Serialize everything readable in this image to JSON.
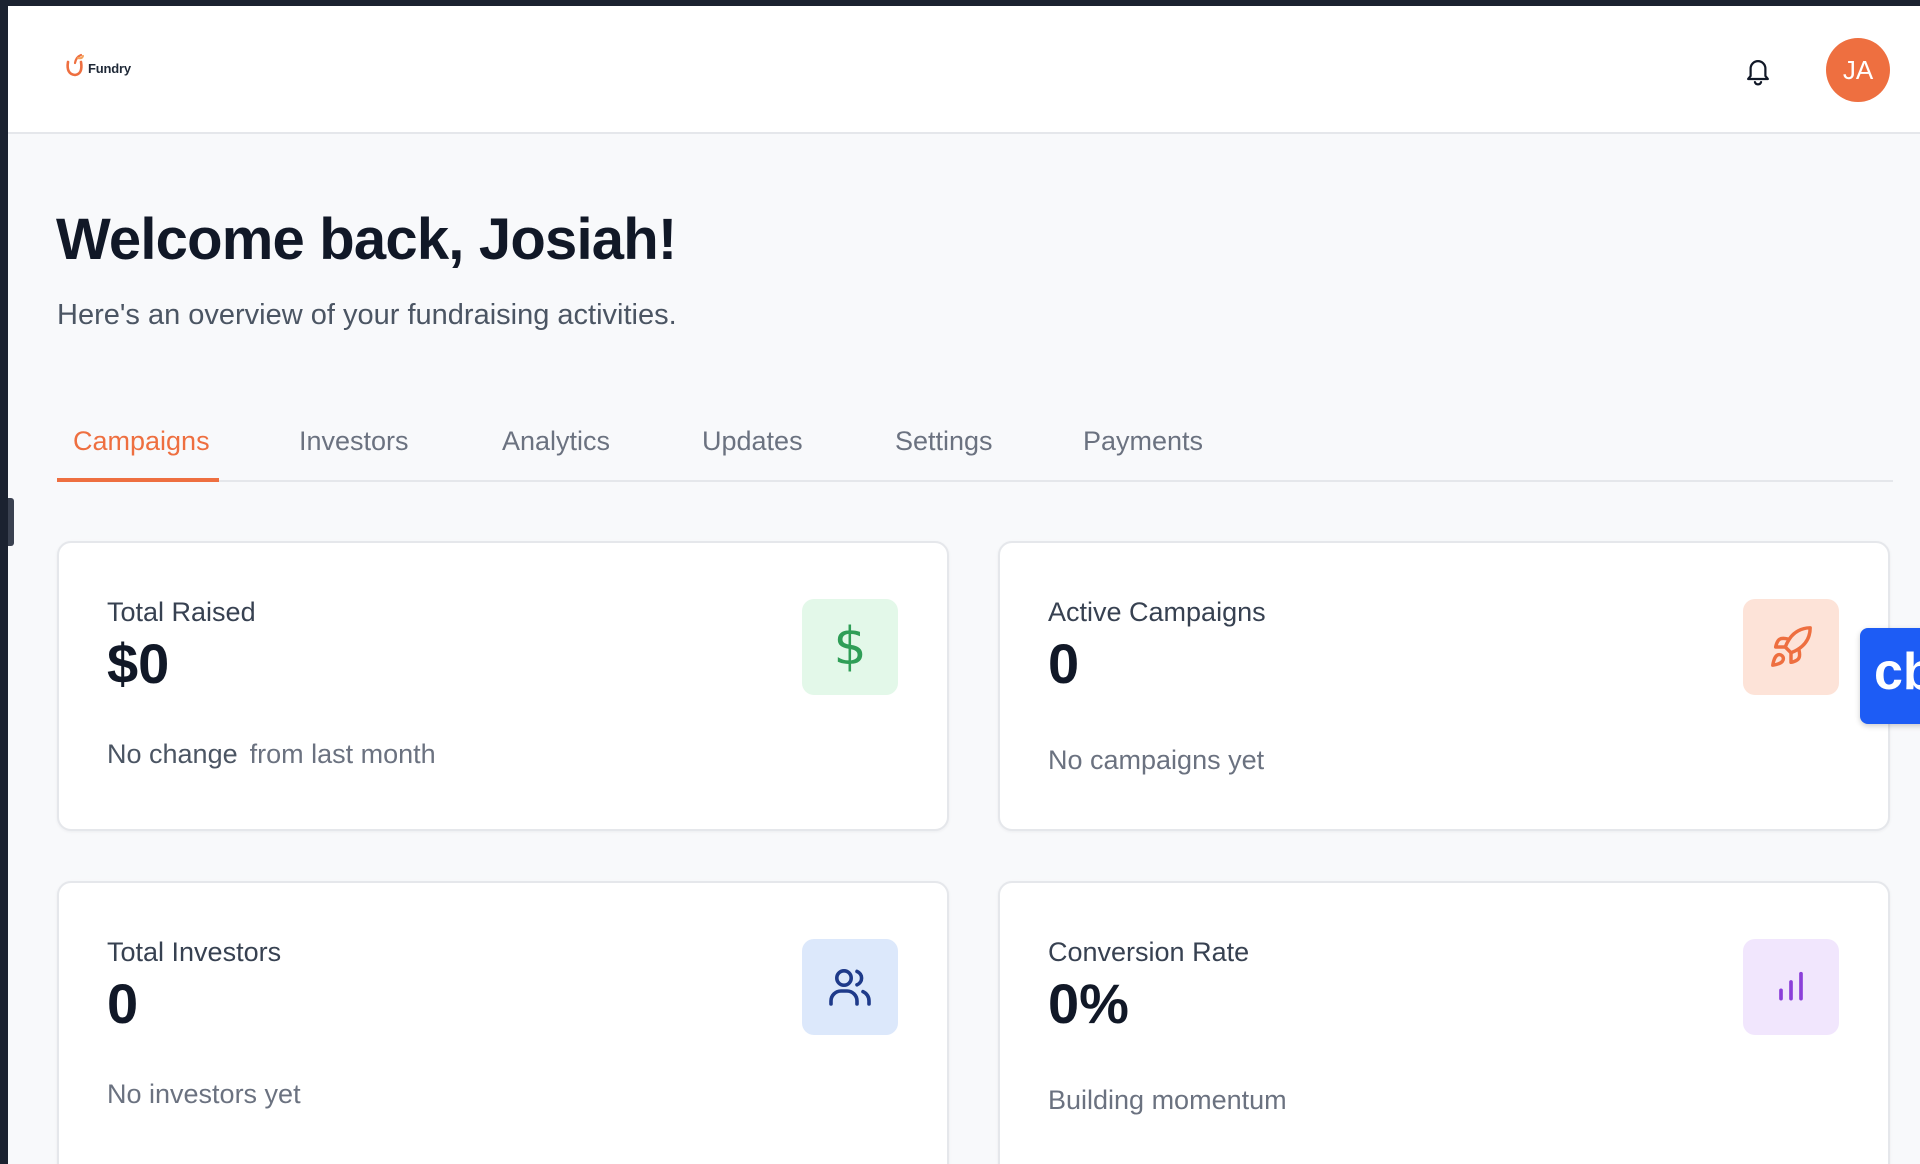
{
  "brand": {
    "name": "Fundry",
    "accent": "#ee6f40"
  },
  "header": {
    "notifications_icon": "bell-icon",
    "avatar_initials": "JA",
    "avatar_color": "#ee6f40"
  },
  "welcome": {
    "title": "Welcome back, Josiah!",
    "subtitle": "Here's an overview of your fundraising activities."
  },
  "tabs": [
    {
      "label": "Campaigns",
      "active": true
    },
    {
      "label": "Investors",
      "active": false
    },
    {
      "label": "Analytics",
      "active": false
    },
    {
      "label": "Updates",
      "active": false
    },
    {
      "label": "Settings",
      "active": false
    },
    {
      "label": "Payments",
      "active": false
    }
  ],
  "stats": {
    "total_raised": {
      "label": "Total Raised",
      "value": "$0",
      "change": "No change",
      "change_suffix": "from last month",
      "icon": "dollar-icon",
      "icon_color": "#2f9e57",
      "tile_color": "#e3f8e9"
    },
    "active_campaigns": {
      "label": "Active Campaigns",
      "value": "0",
      "note": "No campaigns yet",
      "icon": "rocket-icon",
      "icon_color": "#ee6f40",
      "tile_color": "#fde3d8"
    },
    "total_investors": {
      "label": "Total Investors",
      "value": "0",
      "note": "No investors yet",
      "icon": "users-icon",
      "icon_color": "#1e3a8a",
      "tile_color": "#dce8fb"
    },
    "conversion_rate": {
      "label": "Conversion Rate",
      "value": "0%",
      "note": "Building momentum",
      "icon": "bar-chart-icon",
      "icon_color": "#8b3fd9",
      "tile_color": "#f1e6fd"
    }
  },
  "floating_widget": {
    "text": "cb",
    "color": "#1d5cf5"
  }
}
